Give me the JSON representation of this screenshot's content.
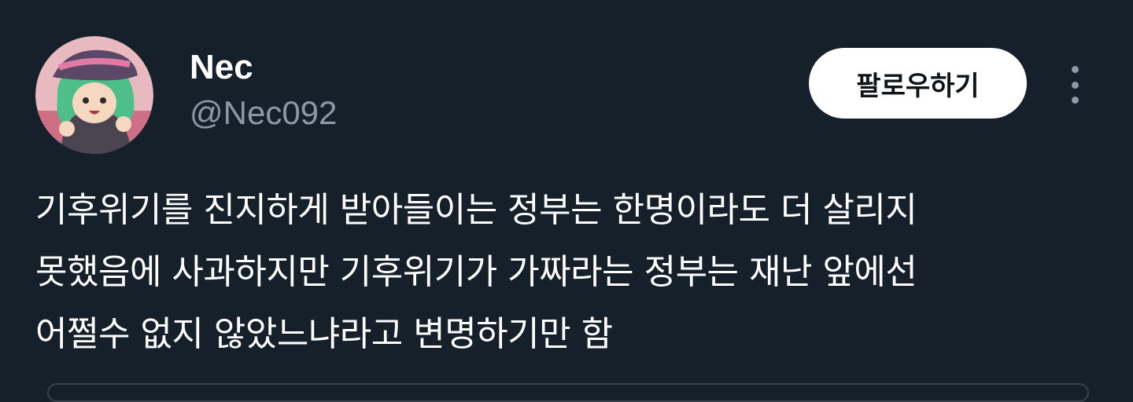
{
  "author": {
    "display_name": "Nec",
    "handle": "@Nec092"
  },
  "actions": {
    "follow_label": "팔로우하기",
    "more_icon": "more-vertical-icon"
  },
  "tweet": {
    "text": "기후위기를 진지하게 받아들이는 정부는 한명이라도 더 살리지\n못했음에 사과하지만 기후위기가 가짜라는 정부는 재난 앞에선\n어쩔수 없지 않았느냐라고 변명하기만 함"
  },
  "colors": {
    "background": "#15202b",
    "text_primary": "#ffffff",
    "text_secondary": "#8b98a5",
    "follow_bg": "#ffffff",
    "follow_text": "#0f1419"
  }
}
